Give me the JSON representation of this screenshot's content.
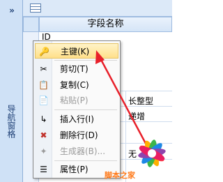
{
  "nav": {
    "toggle": "»",
    "label": "导航窗格"
  },
  "table": {
    "header": "字段名称",
    "first_row": "ID",
    "cells": [
      {
        "text": "长整型",
        "row": 1
      },
      {
        "text": "递增",
        "row": 2
      },
      {
        "text": "无",
        "row": 3
      }
    ]
  },
  "menu": {
    "items": [
      {
        "icon": "🔑",
        "label": "主键(K)",
        "state": "hover"
      },
      {
        "icon": "✂",
        "label": "剪切(T)",
        "state": "normal"
      },
      {
        "icon": "📋",
        "label": "复制(C)",
        "state": "normal"
      },
      {
        "icon": "📄",
        "label": "粘贴(P)",
        "state": "disabled"
      },
      {
        "icon": "↳",
        "label": "插入行(I)",
        "state": "normal"
      },
      {
        "icon": "✖",
        "label": "删除行(D)",
        "state": "normal"
      },
      {
        "icon": "✦",
        "label": "生成器(B)...",
        "state": "disabled"
      },
      {
        "icon": "☰",
        "label": "属性(P)",
        "state": "normal"
      }
    ]
  },
  "watermark": {
    "text": "脚本之家"
  },
  "colors": {
    "arrow": "#e8202a",
    "hover_bg": "#ffe08a",
    "nav_bg": "#cfe1f6"
  }
}
